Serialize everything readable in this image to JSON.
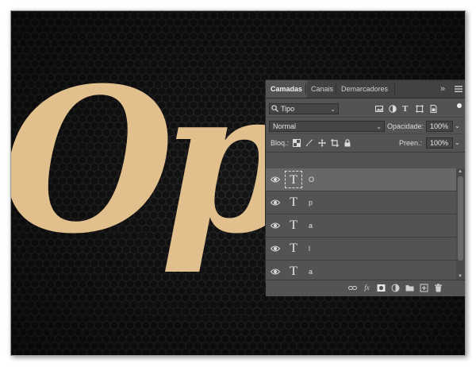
{
  "canvas": {
    "background": "#141414",
    "text_color": "#e2c08d",
    "visible_text": "Opc"
  },
  "panel": {
    "tabs": [
      {
        "label": "Camadas",
        "active": true
      },
      {
        "label": "Canais",
        "active": false
      },
      {
        "label": "Demarcadores",
        "active": false
      }
    ],
    "expand_label": "»",
    "menu_icon": "hamburger-menu-icon",
    "filter": {
      "search_icon": "search-icon",
      "kind_label": "Tipo",
      "filter_icons": [
        "image-filter-icon",
        "adjustment-filter-icon",
        "type-filter-icon",
        "shape-filter-icon",
        "smart-object-filter-icon"
      ]
    },
    "blend": {
      "mode": "Normal",
      "opacity_label": "Opacidade:",
      "opacity_value": "100%"
    },
    "lock": {
      "label": "Bloq.:",
      "lock_icons": [
        "lock-transparent-icon",
        "lock-brush-icon",
        "lock-move-icon",
        "lock-artboard-icon",
        "lock-all-icon"
      ],
      "fill_label": "Preen.:",
      "fill_value": "100%"
    },
    "layers": [
      {
        "name": "O",
        "selected": true
      },
      {
        "name": "p",
        "selected": false
      },
      {
        "name": "a",
        "selected": false
      },
      {
        "name": "l",
        "selected": false
      },
      {
        "name": "a",
        "selected": false
      }
    ],
    "layer_thumb_glyph": "T",
    "footer_icons": [
      "link-icon",
      "fx-icon",
      "mask-icon",
      "adjustment-icon",
      "folder-icon",
      "new-layer-icon",
      "trash-icon"
    ],
    "footer_fx_label": "fx"
  }
}
